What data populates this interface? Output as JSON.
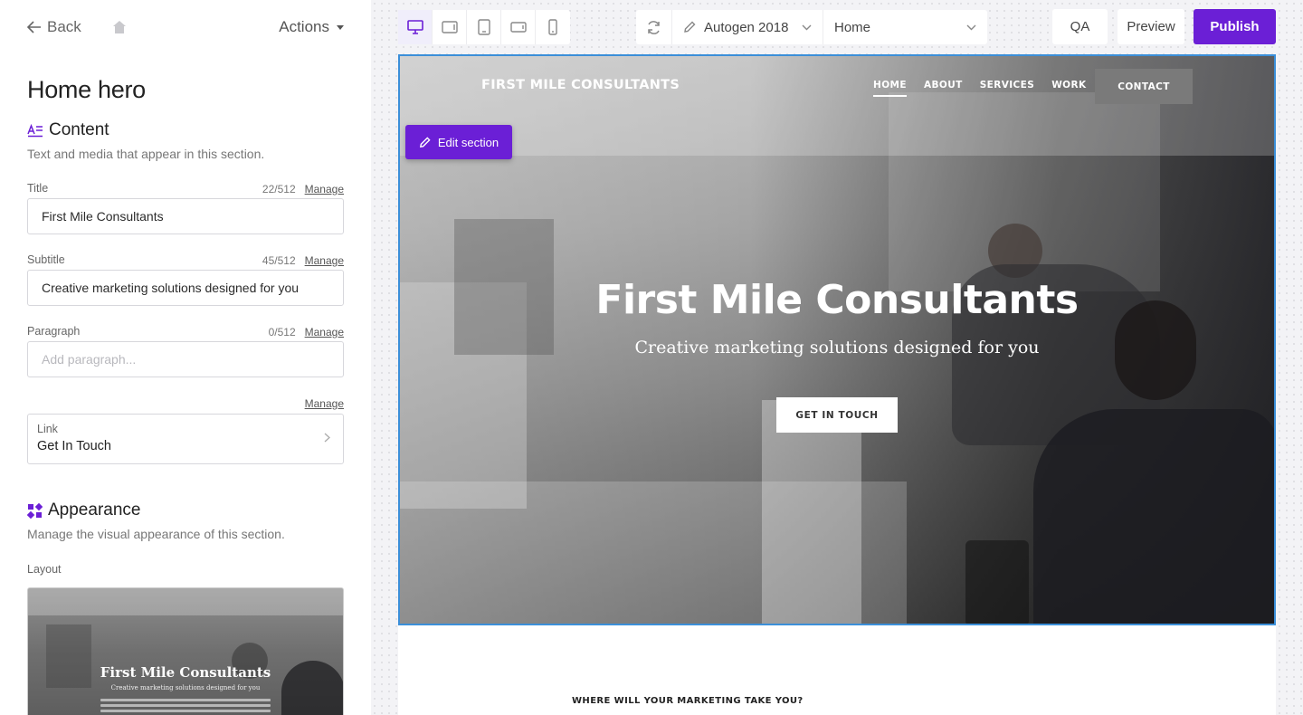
{
  "panel": {
    "back_label": "Back",
    "actions_label": "Actions",
    "title": "Home hero",
    "content": {
      "heading": "Content",
      "description": "Text and media that appear in this section."
    },
    "fields": {
      "title": {
        "label": "Title",
        "count": "22/512",
        "manage": "Manage",
        "value": "First Mile Consultants"
      },
      "subtitle": {
        "label": "Subtitle",
        "count": "45/512",
        "manage": "Manage",
        "value": "Creative marketing solutions designed for you"
      },
      "paragraph": {
        "label": "Paragraph",
        "count": "0/512",
        "manage": "Manage",
        "placeholder": "Add paragraph..."
      },
      "link_manage": "Manage",
      "link": {
        "label": "Link",
        "value": "Get In Touch"
      }
    },
    "appearance": {
      "heading": "Appearance",
      "description": "Manage the visual appearance of this section.",
      "layout_label": "Layout",
      "thumb_title": "First Mile Consultants",
      "thumb_subtitle": "Creative marketing solutions designed for you"
    }
  },
  "toolbar": {
    "site_name": "Autogen 2018",
    "page_name": "Home",
    "qa_label": "QA",
    "preview_label": "Preview",
    "publish_label": "Publish",
    "devices": [
      "desktop-icon",
      "tablet-landscape-icon",
      "tablet-portrait-icon",
      "phone-landscape-icon",
      "phone-portrait-icon"
    ],
    "accent_color": "#6b1fd6"
  },
  "site": {
    "logo": "FIRST MILE CONSULTANTS",
    "menu": [
      "HOME",
      "ABOUT",
      "SERVICES",
      "WORK"
    ],
    "contact": "CONTACT",
    "edit_section": "Edit section",
    "hero_title": "First Mile Consultants",
    "hero_subtitle": "Creative marketing solutions designed for you",
    "hero_cta": "GET IN TOUCH",
    "next_heading": "WHERE WILL YOUR MARKETING TAKE YOU?"
  }
}
